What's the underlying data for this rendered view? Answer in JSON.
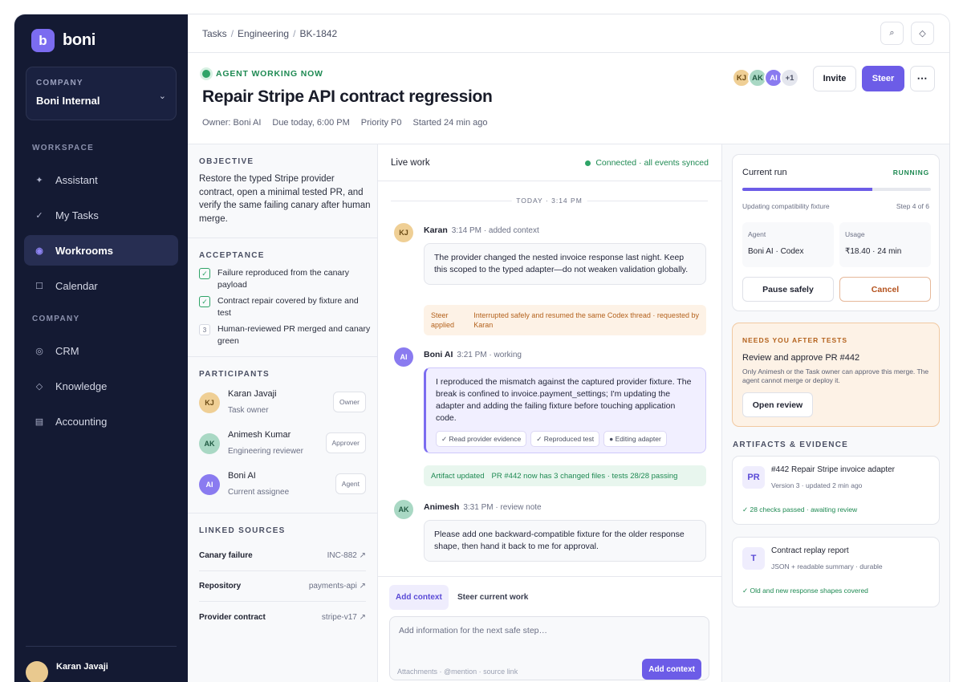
{
  "brand": {
    "logo_letter": "b",
    "name": "boni"
  },
  "company": {
    "label": "COMPANY",
    "value": "Boni Internal"
  },
  "sidebar": {
    "workspace_label": "WORKSPACE",
    "company_label": "COMPANY",
    "workspace_items": [
      {
        "label": "Assistant",
        "icon": "sparkle-icon"
      },
      {
        "label": "My Tasks",
        "icon": "check-icon"
      },
      {
        "label": "Workrooms",
        "icon": "workroom-icon",
        "active": true
      },
      {
        "label": "Calendar",
        "icon": "calendar-icon"
      }
    ],
    "company_items": [
      {
        "label": "CRM",
        "icon": "crm-icon"
      },
      {
        "label": "Knowledge",
        "icon": "knowledge-icon"
      },
      {
        "label": "Accounting",
        "icon": "accounting-icon"
      }
    ],
    "user_name": "Karan Javaji"
  },
  "breadcrumb": [
    "Tasks",
    "Engineering",
    "BK-1842"
  ],
  "header": {
    "status": "AGENT WORKING NOW",
    "title": "Repair Stripe API contract regression",
    "meta": [
      "Owner: Boni AI",
      "Due today, 6:00 PM",
      "Priority P0",
      "Started 24 min ago"
    ],
    "avatars": [
      {
        "initials": "KJ",
        "bg": "#efcf95",
        "fg": "#6a4a14"
      },
      {
        "initials": "AK",
        "bg": "#a9d8c4",
        "fg": "#205a42"
      },
      {
        "initials": "AI",
        "bg": "#8a7bf0",
        "fg": "#ffffff"
      },
      {
        "initials": "+1",
        "bg": "#e4e6ee",
        "fg": "#4a4f63"
      }
    ],
    "invite_label": "Invite",
    "steer_label": "Steer"
  },
  "objective": {
    "heading": "OBJECTIVE",
    "text": "Restore the typed Stripe provider contract, open a minimal tested PR, and verify the same failing canary after human merge."
  },
  "acceptance": {
    "heading": "ACCEPTANCE",
    "items": [
      {
        "text": "Failure reproduced from the canary payload",
        "done": true
      },
      {
        "text": "Contract repair covered by fixture and test",
        "done": true
      },
      {
        "text": "Human-reviewed PR merged and canary green",
        "done": false,
        "num": "3"
      }
    ]
  },
  "participants": {
    "heading": "PARTICIPANTS",
    "items": [
      {
        "initials": "KJ",
        "name": "Karan Javaji",
        "role": "Task owner",
        "tag": "Owner",
        "bg": "#efcf95",
        "fg": "#6a4a14"
      },
      {
        "initials": "AK",
        "name": "Animesh Kumar",
        "role": "Engineering reviewer",
        "tag": "Approver",
        "bg": "#a9d8c4",
        "fg": "#205a42"
      },
      {
        "initials": "AI",
        "name": "Boni AI",
        "role": "Current assignee",
        "tag": "Agent",
        "bg": "#8a7bf0",
        "fg": "#ffffff"
      }
    ]
  },
  "linked_sources": {
    "heading": "LINKED SOURCES",
    "items": [
      {
        "key": "Canary failure",
        "value": "INC-882 ↗"
      },
      {
        "key": "Repository",
        "value": "payments-api ↗"
      },
      {
        "key": "Provider contract",
        "value": "stripe-v17 ↗"
      }
    ]
  },
  "live": {
    "label": "Live work",
    "connection": "Connected · all events synced",
    "today": "TODAY · 3:14 PM",
    "messages": [
      {
        "initials": "KJ",
        "author": "Karan",
        "meta": "3:14 PM · added context",
        "text": "The provider changed the nested invoice response last night. Keep this scoped to the typed adapter—do not weaken validation globally.",
        "bg": "#efcf95",
        "fg": "#6a4a14"
      },
      {
        "initials": "AI",
        "author": "Boni AI",
        "meta": "3:21 PM · working",
        "text": "I reproduced the mismatch against the captured provider fixture. The break is confined to invoice.payment_settings; I'm updating the adapter and adding the failing fixture before touching application code.",
        "bg": "#8a7bf0",
        "fg": "#ffffff",
        "chips": [
          "✓ Read provider evidence",
          "✓ Reproduced test",
          "● Editing adapter"
        ]
      },
      {
        "initials": "AK",
        "author": "Animesh",
        "meta": "3:31 PM · review note",
        "text": "Please add one backward-compatible fixture for the older response shape, then hand it back to me for approval.",
        "bg": "#a9d8c4",
        "fg": "#205a42"
      }
    ],
    "steer_note": {
      "key": "Steer applied",
      "text": "Interrupted safely and resumed the same Codex thread · requested by Karan"
    },
    "artifact_note": {
      "key": "Artifact updated",
      "text": "PR #442 now has 3 changed files · tests 28/28 passing"
    }
  },
  "composer": {
    "tab_add": "Add context",
    "tab_steer": "Steer current work",
    "placeholder": "Add information for the next safe step…",
    "hint": "Attachments · @mention · source link",
    "send_label": "Add context"
  },
  "run": {
    "heading": "Current run",
    "badge": "RUNNING",
    "progress": 0.69,
    "step_text": "Updating compatibility fixture",
    "step_count": "Step 4 of 6",
    "agent_label": "Agent",
    "agent_value": "Boni AI · Codex",
    "usage_label": "Usage",
    "usage_value": "₹18.40 · 24 min",
    "pause_label": "Pause safely",
    "cancel_label": "Cancel"
  },
  "needs": {
    "heading": "NEEDS YOU AFTER TESTS",
    "title": "Review and approve PR #442",
    "desc": "Only Animesh or the Task owner can approve this merge. The agent cannot merge or deploy it.",
    "button": "Open review"
  },
  "artifacts": {
    "heading": "ARTIFACTS & EVIDENCE",
    "items": [
      {
        "icon_text": "PR",
        "title": "#442 Repair Stripe invoice adapter",
        "sub": "Version 3 · updated 2 min ago",
        "status": "✓ 28 checks passed · awaiting review"
      },
      {
        "icon_text": "T",
        "title": "Contract replay report",
        "sub": "JSON + readable summary · durable",
        "status": "✓ Old and new response shapes covered"
      }
    ]
  },
  "colors": {
    "accent": "#6c5ce7",
    "sidebar_bg": "#141a33",
    "success": "#2ea467",
    "warning": "#b4621d"
  }
}
